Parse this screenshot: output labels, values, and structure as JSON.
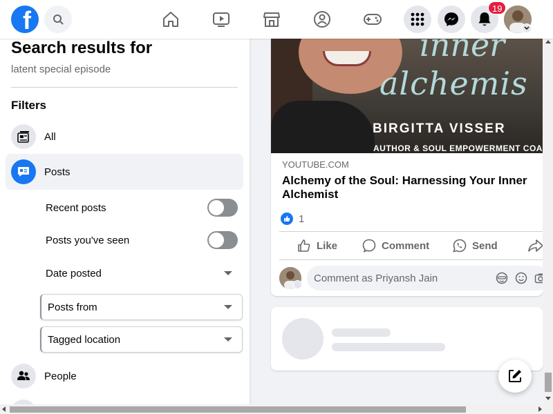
{
  "topbar": {
    "logo_letter": "f",
    "icons": [
      "search-icon",
      "home-icon",
      "video-icon",
      "marketplace-icon",
      "groups-icon",
      "gaming-icon",
      "menu-grid-icon",
      "messenger-icon",
      "bell-icon"
    ],
    "notification_count": "19",
    "accent_color": "#1877f2",
    "badge_color": "#e41e3f"
  },
  "left_panel": {
    "title": "Search results for",
    "query": "latent special episode",
    "filters_heading": "Filters",
    "filters": [
      {
        "label": "All",
        "icon": "feed-icon"
      },
      {
        "label": "Posts",
        "icon": "posts-icon",
        "active": true
      },
      {
        "label": "People",
        "icon": "people-icon"
      }
    ],
    "post_options": {
      "recent_posts": "Recent posts",
      "recent_posts_on": false,
      "posts_seen": "Posts you've seen",
      "posts_seen_on": false,
      "date_posted": "Date posted",
      "posts_from": "Posts from",
      "tagged_location": "Tagged location"
    }
  },
  "post": {
    "thumbnail": {
      "word1": "inner",
      "word2": "alchemis",
      "name": "BIRGITTA VISSER",
      "subtitle": "AUTHOR & SOUL EMPOWERMENT COACH"
    },
    "domain": "YOUTUBE.COM",
    "title": "Alchemy of the Soul: Harnessing Your Inner Alchemist",
    "like_count": "1",
    "actions": {
      "like": "Like",
      "comment": "Comment",
      "send": "Send"
    },
    "comment_placeholder": "Comment as Priyansh Jain"
  }
}
